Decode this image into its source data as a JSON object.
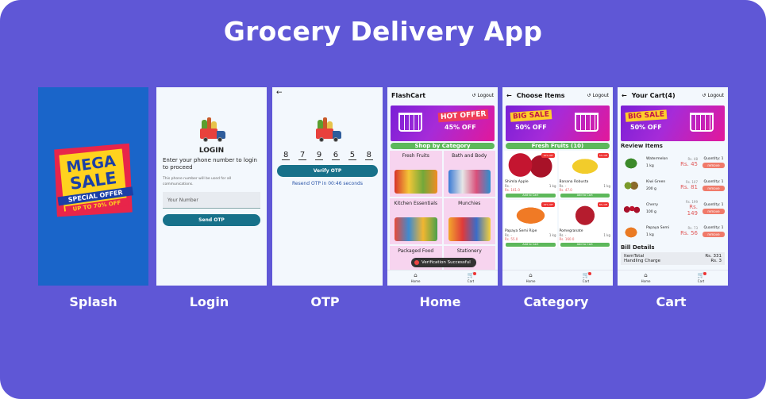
{
  "title": "Grocery Delivery App",
  "captions": [
    "Splash",
    "Login",
    "OTP",
    "Home",
    "Category",
    "Cart"
  ],
  "splash": {
    "line1": "MEGA",
    "line2": "SALE",
    "line3": "SPECIAL OFFER",
    "line4": "UP TO 70% OFF"
  },
  "login": {
    "heading": "LOGIN",
    "prompt": "Enter your phone number to login to proceed",
    "note": "This phone number will be used for all communications.",
    "input_placeholder": "Your Number",
    "button": "Send OTP"
  },
  "otp": {
    "back_icon": "arrow-left-icon",
    "digits": [
      "8",
      "7",
      "9",
      "6",
      "5",
      "8"
    ],
    "button": "Verify OTP",
    "resend": "Resend OTP in 00:46 seconds"
  },
  "home": {
    "app_name": "FlashCart",
    "logout": "Logout",
    "banner_label": "HOT OFFER",
    "banner_percent": "45% OFF",
    "section": "Shop by Category",
    "categories": [
      "Fresh Fruits",
      "Bath and Body",
      "Kitchen Essentials",
      "Munchies",
      "Packaged Food",
      "Stationery"
    ],
    "toast": "Verification Successful"
  },
  "category": {
    "title": "Choose Items",
    "logout": "Logout",
    "banner_label": "BIG SALE",
    "banner_percent": "50% OFF",
    "section": "Fresh Fruits (10)",
    "items": [
      {
        "name": "Shimla Apple",
        "qty": "1 kg",
        "old": "Rs. -",
        "price": "Rs. 161.0",
        "disc": "10% Off",
        "color": "#b3122a"
      },
      {
        "name": "Banana Robusta",
        "qty": "1 kg",
        "old": "Rs. -",
        "price": "Rs. 47.0",
        "disc": "5% Off",
        "color": "#f1c92a"
      },
      {
        "name": "Papaya Semi Ripe",
        "qty": "1 kg",
        "old": "Rs. -",
        "price": "Rs. 55.0",
        "disc": "15% Off",
        "color": "#ef7a25"
      },
      {
        "name": "Pomegranate",
        "qty": "1 kg",
        "old": "Rs. -",
        "price": "Rs. 160.0",
        "disc": "8% Off",
        "color": "#b51c2e"
      }
    ],
    "add_label": "Add to Cart"
  },
  "cart": {
    "title": "Your Cart(4)",
    "logout": "Logout",
    "banner_label": "BIG SALE",
    "banner_percent": "50% OFF",
    "review": "Review Items",
    "rows": [
      {
        "name": "Watermelon",
        "qty": "1 kg",
        "old": "Rs. 48",
        "price": "Rs. 45",
        "count": "Quantity: 1",
        "color": "#3c8a2a"
      },
      {
        "name": "Kiwi Green",
        "qty": "200 g",
        "old": "Rs. 107",
        "price": "Rs. 81",
        "count": "Quantity: 1",
        "color": "#8a6a2a"
      },
      {
        "name": "Cherry",
        "qty": "100 g",
        "old": "Rs. 199",
        "price": "Rs. 149",
        "count": "Quantity: 1",
        "color": "#a8102a"
      },
      {
        "name": "Papaya Semi",
        "qty": "1 kg",
        "old": "Rs. 73",
        "price": "Rs. 56",
        "count": "Quantity: 1",
        "color": "#ea7a23"
      }
    ],
    "remove": "remove",
    "bill_title": "Bill Details",
    "bill": [
      {
        "label": "ItemTotal",
        "value": "Rs. 331"
      },
      {
        "label": "Handling Charge",
        "value": "Rs. 3"
      }
    ]
  },
  "nav": {
    "home": "Home",
    "cart": "Cart"
  },
  "colors": {
    "background": "#5f57d6",
    "primary": "#17718a",
    "accent": "#5db85b",
    "sale": "#e05a5a"
  }
}
